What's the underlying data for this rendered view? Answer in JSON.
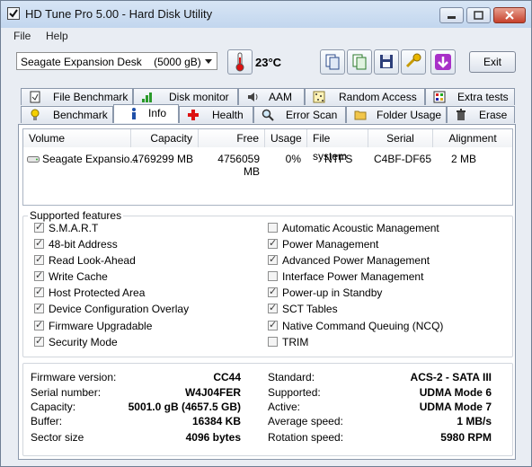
{
  "window": {
    "title": "HD Tune Pro 5.00 - Hard Disk Utility"
  },
  "menu": [
    "File",
    "Help"
  ],
  "toolbar": {
    "drive": "Seagate Expansion Desk    (5000 gB)",
    "temperature": "23°C",
    "exit_label": "Exit"
  },
  "tabs_row1": [
    "File Benchmark",
    "Disk monitor",
    "AAM",
    "Random Access",
    "Extra tests"
  ],
  "tabs_row2": [
    "Benchmark",
    "Info",
    "Health",
    "Error Scan",
    "Folder Usage",
    "Erase"
  ],
  "active_tab": "Info",
  "volume_table": {
    "headers": [
      "Volume",
      "Capacity",
      "Free",
      "Usage",
      "File system",
      "Serial",
      "Alignment"
    ],
    "rows": [
      [
        "Seagate Expansio...",
        "4769299 MB",
        "4756059 MB",
        "0%",
        "NTFS",
        "C4BF-DF65",
        "2 MB"
      ]
    ]
  },
  "features": {
    "title": "Supported features",
    "left": [
      {
        "label": "S.M.A.R.T",
        "checked": true
      },
      {
        "label": "48-bit Address",
        "checked": true
      },
      {
        "label": "Read Look-Ahead",
        "checked": true
      },
      {
        "label": "Write Cache",
        "checked": true
      },
      {
        "label": "Host Protected Area",
        "checked": true
      },
      {
        "label": "Device Configuration Overlay",
        "checked": true
      },
      {
        "label": "Firmware Upgradable",
        "checked": true
      },
      {
        "label": "Security Mode",
        "checked": true
      }
    ],
    "right": [
      {
        "label": "Automatic Acoustic Management",
        "checked": false
      },
      {
        "label": "Power Management",
        "checked": true
      },
      {
        "label": "Advanced Power Management",
        "checked": true
      },
      {
        "label": "Interface Power Management",
        "checked": false
      },
      {
        "label": "Power-up in Standby",
        "checked": true
      },
      {
        "label": "SCT Tables",
        "checked": true
      },
      {
        "label": "Native Command Queuing (NCQ)",
        "checked": true
      },
      {
        "label": "TRIM",
        "checked": false
      }
    ]
  },
  "info_left": [
    {
      "label": "Firmware version:",
      "value": "CC44"
    },
    {
      "label": "Serial number:",
      "value": "W4J04FER"
    },
    {
      "label": "Capacity:",
      "value": "5001.0 gB (4657.5 GB)"
    },
    {
      "label": "Buffer:",
      "value": "16384 KB"
    },
    {
      "label": "Sector size",
      "value": "4096 bytes"
    }
  ],
  "info_right": [
    {
      "label": "Standard:",
      "value": "ACS-2 - SATA III"
    },
    {
      "label": "Supported:",
      "value": "UDMA Mode 6"
    },
    {
      "label": "Active:",
      "value": "UDMA Mode 7"
    },
    {
      "label": "Average speed:",
      "value": "1 MB/s"
    },
    {
      "label": "Rotation speed:",
      "value": "5980 RPM"
    }
  ]
}
